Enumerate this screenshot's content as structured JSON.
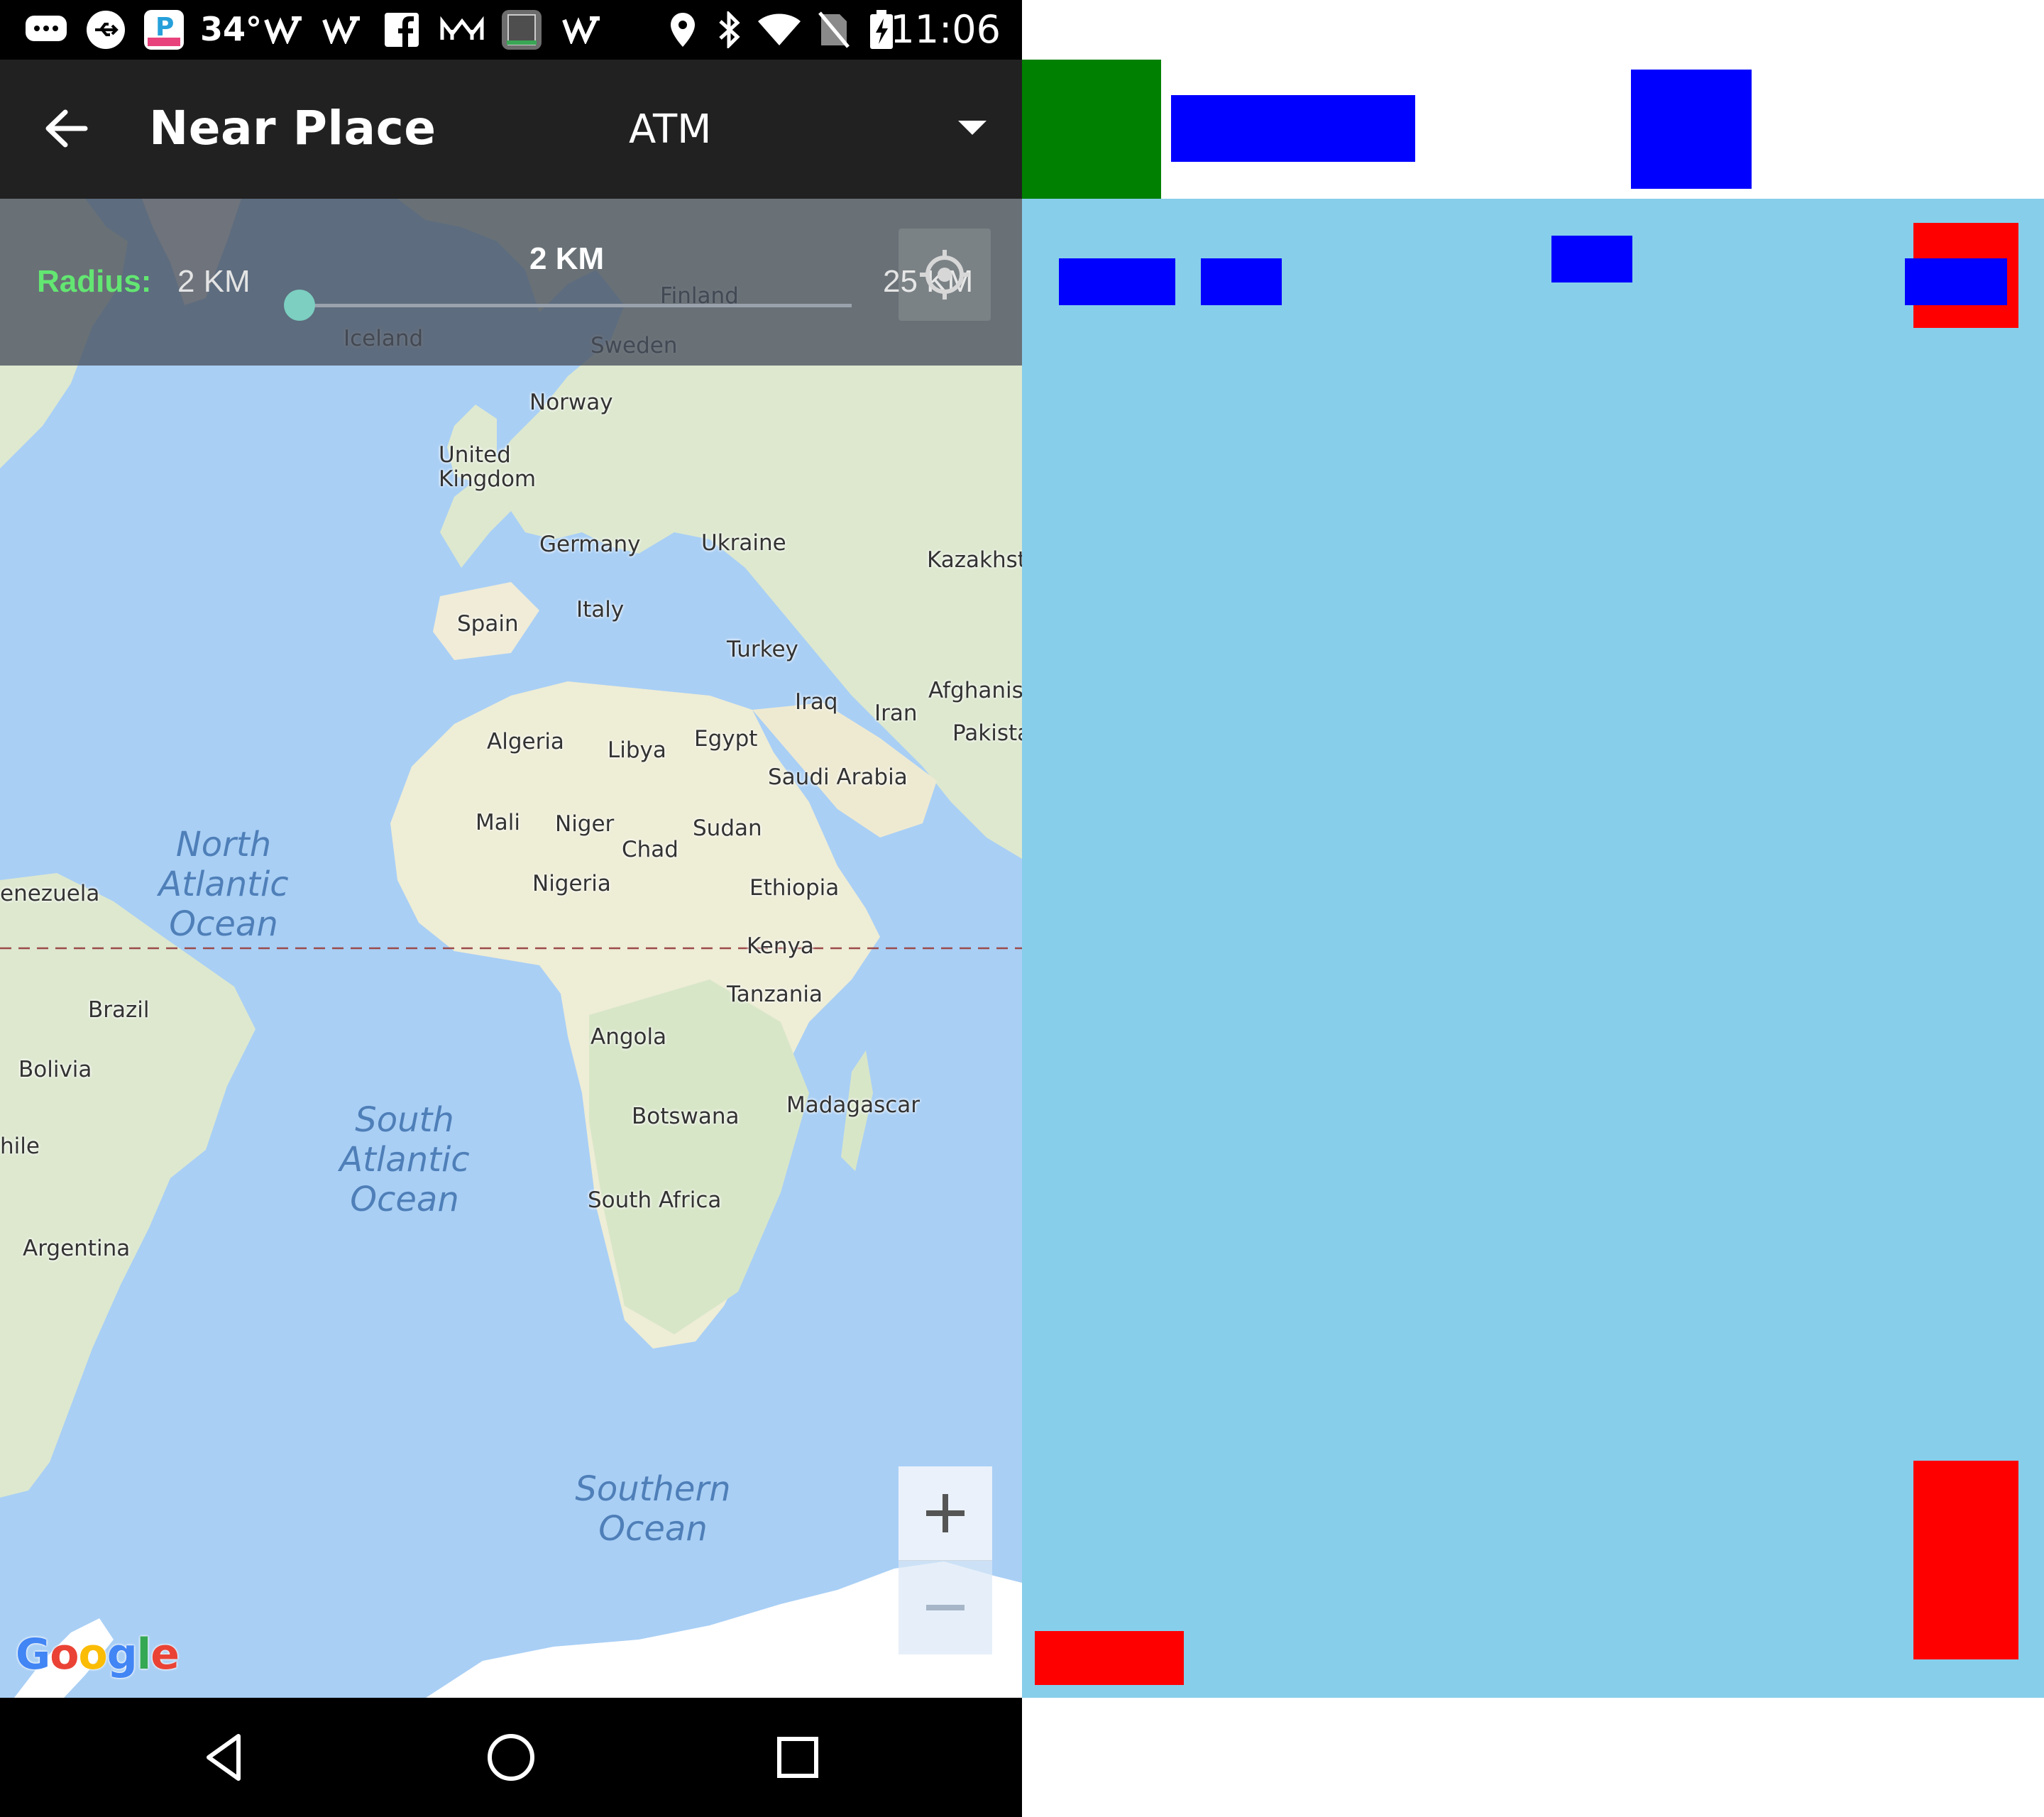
{
  "status_bar": {
    "temperature": "34°",
    "time": "11:06",
    "icons": [
      "chat-icon",
      "usb-icon",
      "parking-app-icon",
      "w-notification-icon",
      "w-notification-icon",
      "facebook-icon",
      "mm-icon",
      "bible-app-icon",
      "w-notification-icon",
      "location-icon",
      "bluetooth-icon",
      "wifi-icon",
      "no-sim-icon",
      "battery-charging-icon"
    ]
  },
  "app_bar": {
    "title": "Near Place",
    "place_type": "ATM"
  },
  "radius": {
    "label": "Radius:",
    "min_label": "2 KM",
    "current_label": "2 KM",
    "max_label": "25 KM",
    "slider_position": 0.0
  },
  "map": {
    "countries": [
      {
        "name": "Iceland"
      },
      {
        "name": "Finland"
      },
      {
        "name": "Sweden"
      },
      {
        "name": "Norway"
      },
      {
        "name": "United\nKingdom"
      },
      {
        "name": "Germany"
      },
      {
        "name": "Ukraine"
      },
      {
        "name": "Kazakhsta"
      },
      {
        "name": "Spain"
      },
      {
        "name": "Italy"
      },
      {
        "name": "Turkey"
      },
      {
        "name": "Iraq"
      },
      {
        "name": "Iran"
      },
      {
        "name": "Afghanist"
      },
      {
        "name": "Pakista"
      },
      {
        "name": "Algeria"
      },
      {
        "name": "Libya"
      },
      {
        "name": "Egypt"
      },
      {
        "name": "Saudi Arabia"
      },
      {
        "name": "Mali"
      },
      {
        "name": "Niger"
      },
      {
        "name": "Sudan"
      },
      {
        "name": "Chad"
      },
      {
        "name": "Nigeria"
      },
      {
        "name": "Ethiopia"
      },
      {
        "name": "enezuela"
      },
      {
        "name": "Kenya"
      },
      {
        "name": "Tanzania"
      },
      {
        "name": "Brazil"
      },
      {
        "name": "Angola"
      },
      {
        "name": "Bolivia"
      },
      {
        "name": "Madagascar"
      },
      {
        "name": "Botswana"
      },
      {
        "name": "hile"
      },
      {
        "name": "South Africa"
      },
      {
        "name": "Argentina"
      }
    ],
    "oceans": [
      {
        "name": "North\nAtlantic\nOcean"
      },
      {
        "name": "South\nAtlantic\nOcean"
      },
      {
        "name": "Southern\nOcean"
      }
    ],
    "attribution": "Google"
  },
  "zoom": {
    "in": "+",
    "out": "−"
  },
  "colors": {
    "accent_green": "#63e672",
    "slider_thumb": "#7ccfc1",
    "app_bar": "#212121",
    "ocean": "#a9cff5",
    "land": "#f5f1e4",
    "panel_bg": "#87ceeb",
    "box_green": "#008000",
    "box_blue": "#0000ff",
    "box_red": "#ff0000"
  }
}
